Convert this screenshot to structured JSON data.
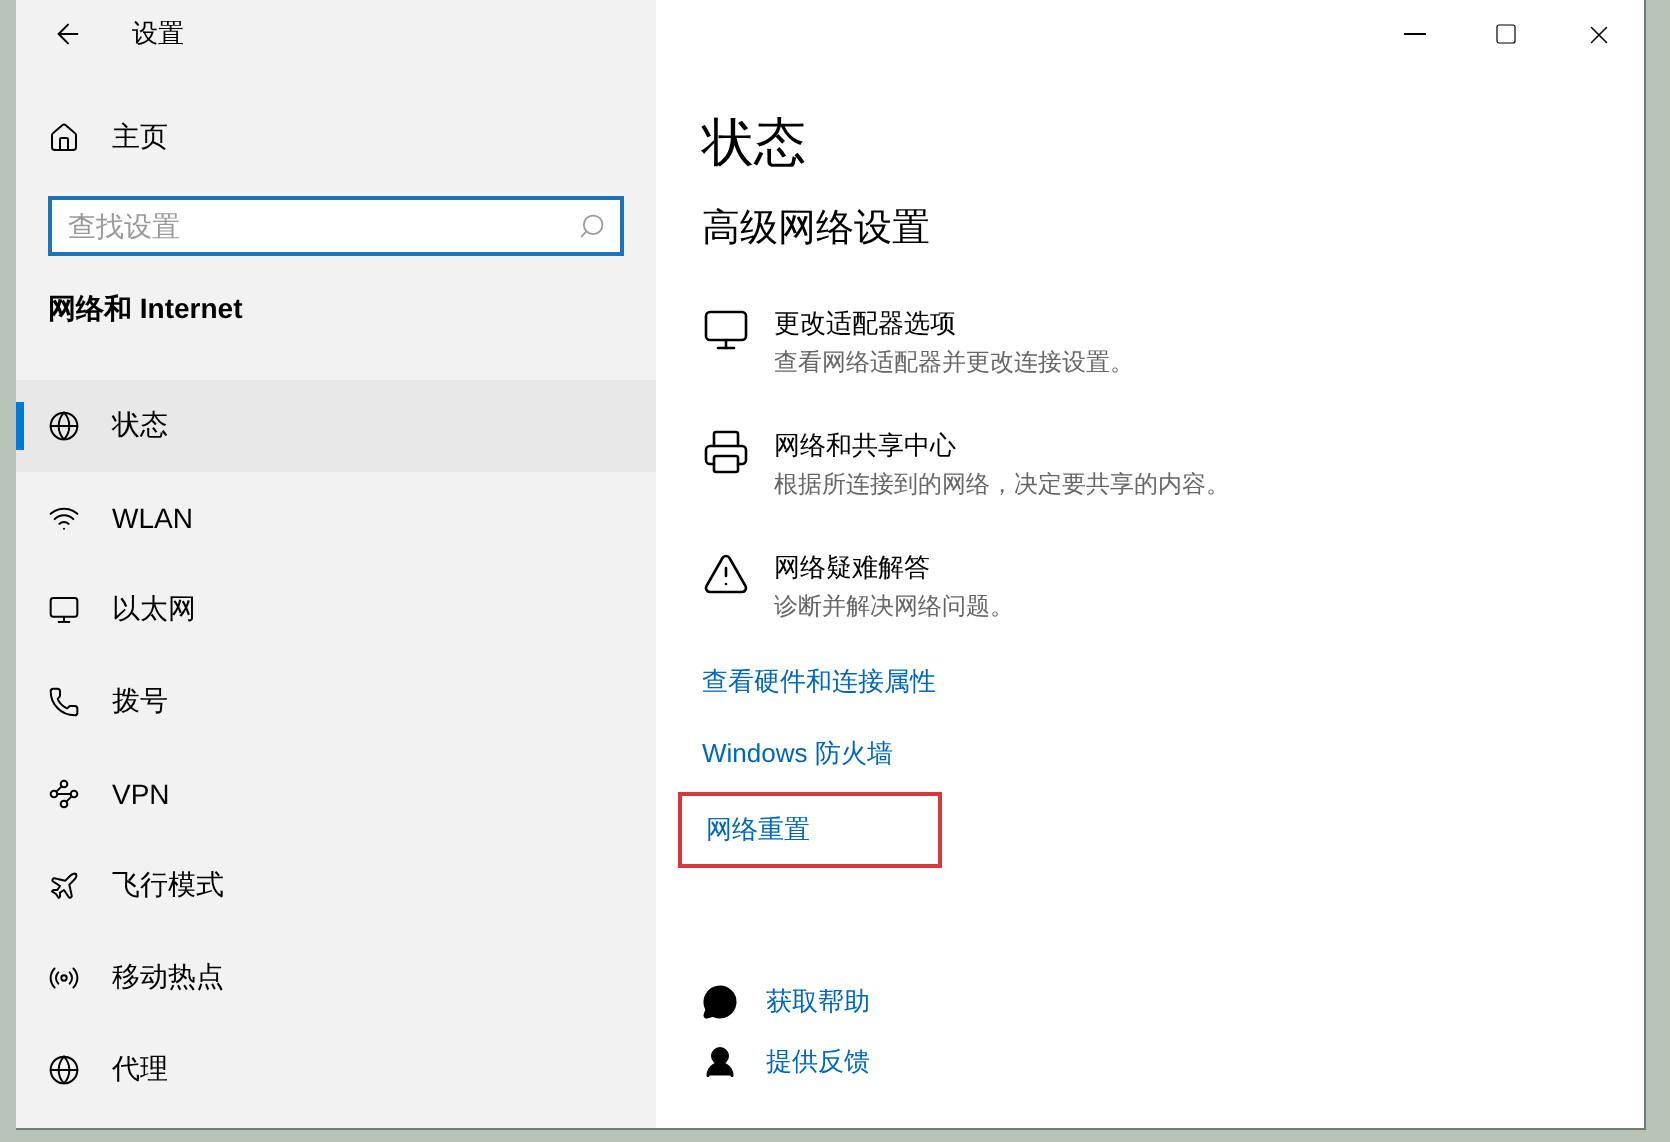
{
  "window": {
    "title": "设置"
  },
  "sidebar": {
    "home": "主页",
    "search": {
      "placeholder": "查找设置"
    },
    "section": "网络和 Internet",
    "items": [
      {
        "label": "状态",
        "selected": true
      },
      {
        "label": "WLAN",
        "selected": false
      },
      {
        "label": "以太网",
        "selected": false
      },
      {
        "label": "拨号",
        "selected": false
      },
      {
        "label": "VPN",
        "selected": false
      },
      {
        "label": "飞行模式",
        "selected": false
      },
      {
        "label": "移动热点",
        "selected": false
      },
      {
        "label": "代理",
        "selected": false
      }
    ]
  },
  "main": {
    "title": "状态",
    "heading": "高级网络设置",
    "options": [
      {
        "title": "更改适配器选项",
        "description": "查看网络适配器并更改连接设置。"
      },
      {
        "title": "网络和共享中心",
        "description": "根据所连接到的网络，决定要共享的内容。"
      },
      {
        "title": "网络疑难解答",
        "description": "诊断并解决网络问题。"
      }
    ],
    "links": [
      {
        "label": "查看硬件和连接属性",
        "highlighted": false
      },
      {
        "label": "Windows 防火墙",
        "highlighted": false
      },
      {
        "label": "网络重置",
        "highlighted": true
      }
    ],
    "help": [
      {
        "label": "获取帮助"
      },
      {
        "label": "提供反馈"
      }
    ]
  }
}
